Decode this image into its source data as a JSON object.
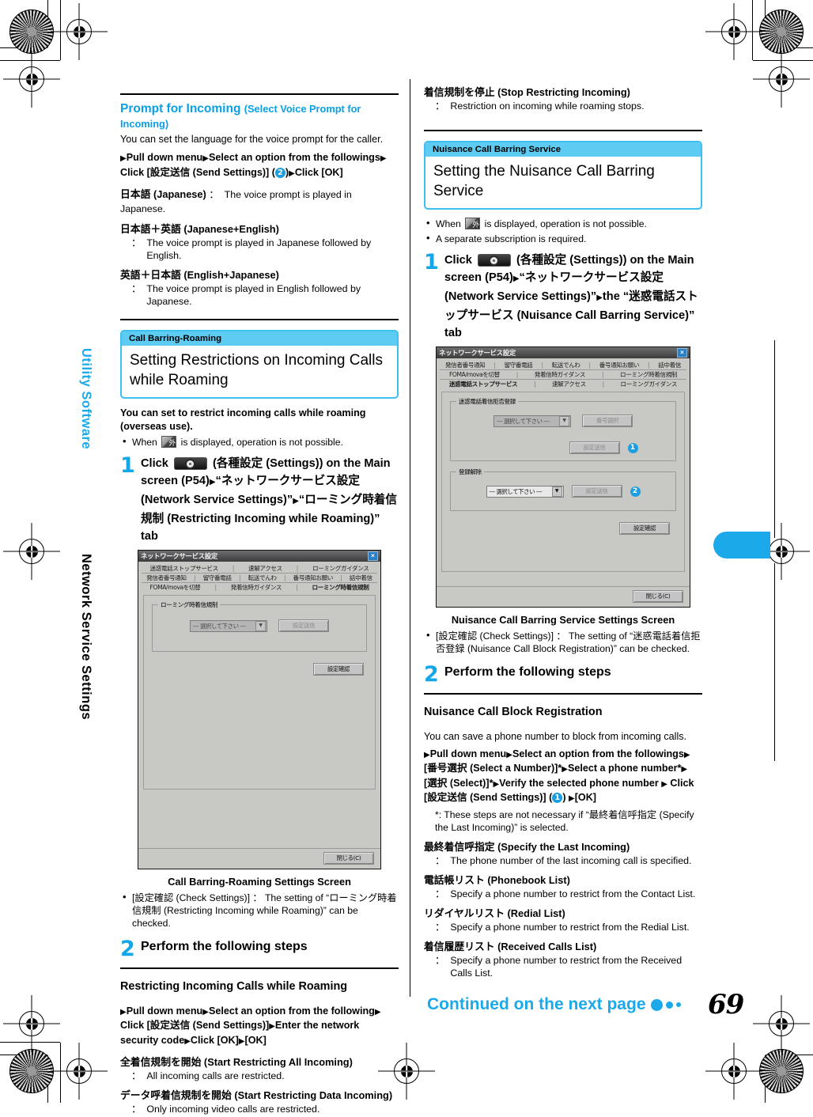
{
  "page": {
    "number": "69",
    "continued_label": "Continued on the next page",
    "side_tab_upper": "Utility Software",
    "side_tab_lower": "Network Service Settings"
  },
  "left_column": {
    "prompt_section": {
      "heading_main": "Prompt for Incoming",
      "heading_paren": "(Select Voice Prompt for Incoming)",
      "intro": "You can set the language for the voice prompt for the caller.",
      "steps": "Pull down menu Select an option from the followings Click [設定送信 (Send Settings)] ( ) Click [OK]",
      "steps_badge": "2",
      "options": [
        {
          "term": "日本語 (Japanese)",
          "def": "The voice prompt is played in Japanese.",
          "inline": true
        },
        {
          "term": "日本語＋英語 (Japanese+English)",
          "def": "The voice prompt is played in Japanese followed by English.",
          "inline": false
        },
        {
          "term": "英語＋日本語 (English+Japanese)",
          "def": "The voice prompt is played in English followed by Japanese.",
          "inline": false
        }
      ]
    },
    "call_barring_section": {
      "tag": "Call Barring-Roaming",
      "title": "Setting Restrictions on Incoming Calls while Roaming",
      "lead": "You can set to restrict incoming calls while roaming (overseas use).",
      "bullets": [
        "When  is displayed, operation is not possible."
      ],
      "step1": {
        "number": "1",
        "text": "Click  (各種設定 (Settings)) on the Main screen (P54) “ネットワークサービス設定 (Network Service Settings)” “ローミング時着信規制 (Restricting Incoming while Roaming)” tab"
      },
      "screenshot_caption": "Call Barring-Roaming Settings Screen",
      "screenshot_note": "[設定確認 (Check Settings)] ： The setting of “ローミング時着信規制 (Restricting Incoming while Roaming)” can be checked.",
      "step2": {
        "number": "2",
        "text": "Perform the following steps"
      },
      "subheading": "Restricting Incoming Calls while Roaming",
      "sub_steps": "Pull down menu Select an option from the following Click [設定送信 (Send Settings)] Enter the network security code Click [OK] [OK]",
      "options": [
        {
          "term": "全着信規制を開始 (Start Restricting All Incoming)",
          "def": "All incoming calls are restricted."
        },
        {
          "term": "データ呼着信規制を開始 (Start Restricting Data Incoming)",
          "def": "Only incoming video calls are restricted."
        }
      ]
    },
    "dialog": {
      "title": "ネットワークサービス設定",
      "close_label": "×",
      "tab_rows": [
        [
          "迷惑電話ストップサービス",
          "速解アクセス",
          "ローミングガイダンス"
        ],
        [
          "発信者番号通知",
          "留守番電話",
          "転送でんわ",
          "番号通知お願い",
          "話中着信"
        ],
        [
          "FOMA/movaを切替",
          "発着信時ガイダンス",
          "ローミング時着信規制"
        ]
      ],
      "group_label": "ローミング時着信規制",
      "combo_value": "― 選択して下さい ―",
      "send_button": "設定送信",
      "check_button": "設定確認",
      "close_button": "閉じる(C)"
    }
  },
  "right_column": {
    "stop_restricting": {
      "term": "着信規制を停止 (Stop Restricting Incoming)",
      "def": "Restriction on incoming while roaming stops."
    },
    "nuisance_section": {
      "tag": "Nuisance Call Barring Service",
      "title": "Setting the Nuisance Call Barring Service",
      "bullets": [
        "When  is displayed, operation is not possible.",
        "A separate subscription is required."
      ],
      "step1": {
        "number": "1",
        "text": "Click  (各種設定 (Settings)) on the Main screen (P54) “ネットワークサービス設定 (Network Service Settings)” the “迷惑電話ストップサービス (Nuisance Call Barring Service)” tab"
      },
      "screenshot_caption": "Nuisance Call Barring Service Settings Screen",
      "screenshot_note": "[設定確認 (Check Settings)] ： The setting of “迷惑電話着信拒否登録 (Nuisance Call Block Registration)” can be checked.",
      "step2": {
        "number": "2",
        "text": "Perform the following steps"
      },
      "subheading": "Nuisance Call Block Registration",
      "sub_intro": "You can save a phone number to block from incoming calls.",
      "sub_steps": "Pull down menu Select an option from the followings [番号選択 (Select a Number)]* Select a phone number* [選択 (Select)]* Verify the selected phone number Click [設定送信 (Send Settings)] ( ) [OK]",
      "sub_steps_badge": "1",
      "footnote": "*: These steps are not necessary if “最終着信呼指定 (Specify the Last Incoming)” is selected.",
      "options": [
        {
          "term": "最終着信呼指定 (Specify the Last Incoming)",
          "def": "The phone number of the last incoming call is specified."
        },
        {
          "term": "電話帳リスト (Phonebook List)",
          "def": "Specify a phone number to restrict from the Contact List."
        },
        {
          "term": "リダイヤルリスト (Redial List)",
          "def": "Specify a phone number to restrict from the Redial List."
        },
        {
          "term": "着信履歴リスト (Received Calls List)",
          "def": "Specify a phone number to restrict from the Received Calls List."
        }
      ]
    },
    "dialog": {
      "title": "ネットワークサービス設定",
      "close_label": "×",
      "tab_rows": [
        [
          "発信者番号通知",
          "留守番電話",
          "転送でんわ",
          "番号通知お願い",
          "話中着信"
        ],
        [
          "FOMA/movaを切替",
          "発着信時ガイダンス",
          "ローミング時着信規制"
        ],
        [
          "迷惑電話ストップサービス",
          "速解アクセス",
          "ローミングガイダンス"
        ]
      ],
      "group1_label": "迷惑電話着信拒否登録",
      "group1_combo": "― 選択して下さい ―",
      "group1_number_button": "番号選択",
      "group1_send_button": "設定送信",
      "group1_badge": "1",
      "group2_label": "登録解除",
      "group2_combo": "― 選択して下さい ―",
      "group2_send_button": "設定送信",
      "group2_badge": "2",
      "check_button": "設定確認",
      "close_button": "閉じる(C)"
    }
  },
  "colors": {
    "accent_blue": "#1ba9ea",
    "section_tag": "#5ecbf2",
    "section_border": "#3cc0f0"
  }
}
